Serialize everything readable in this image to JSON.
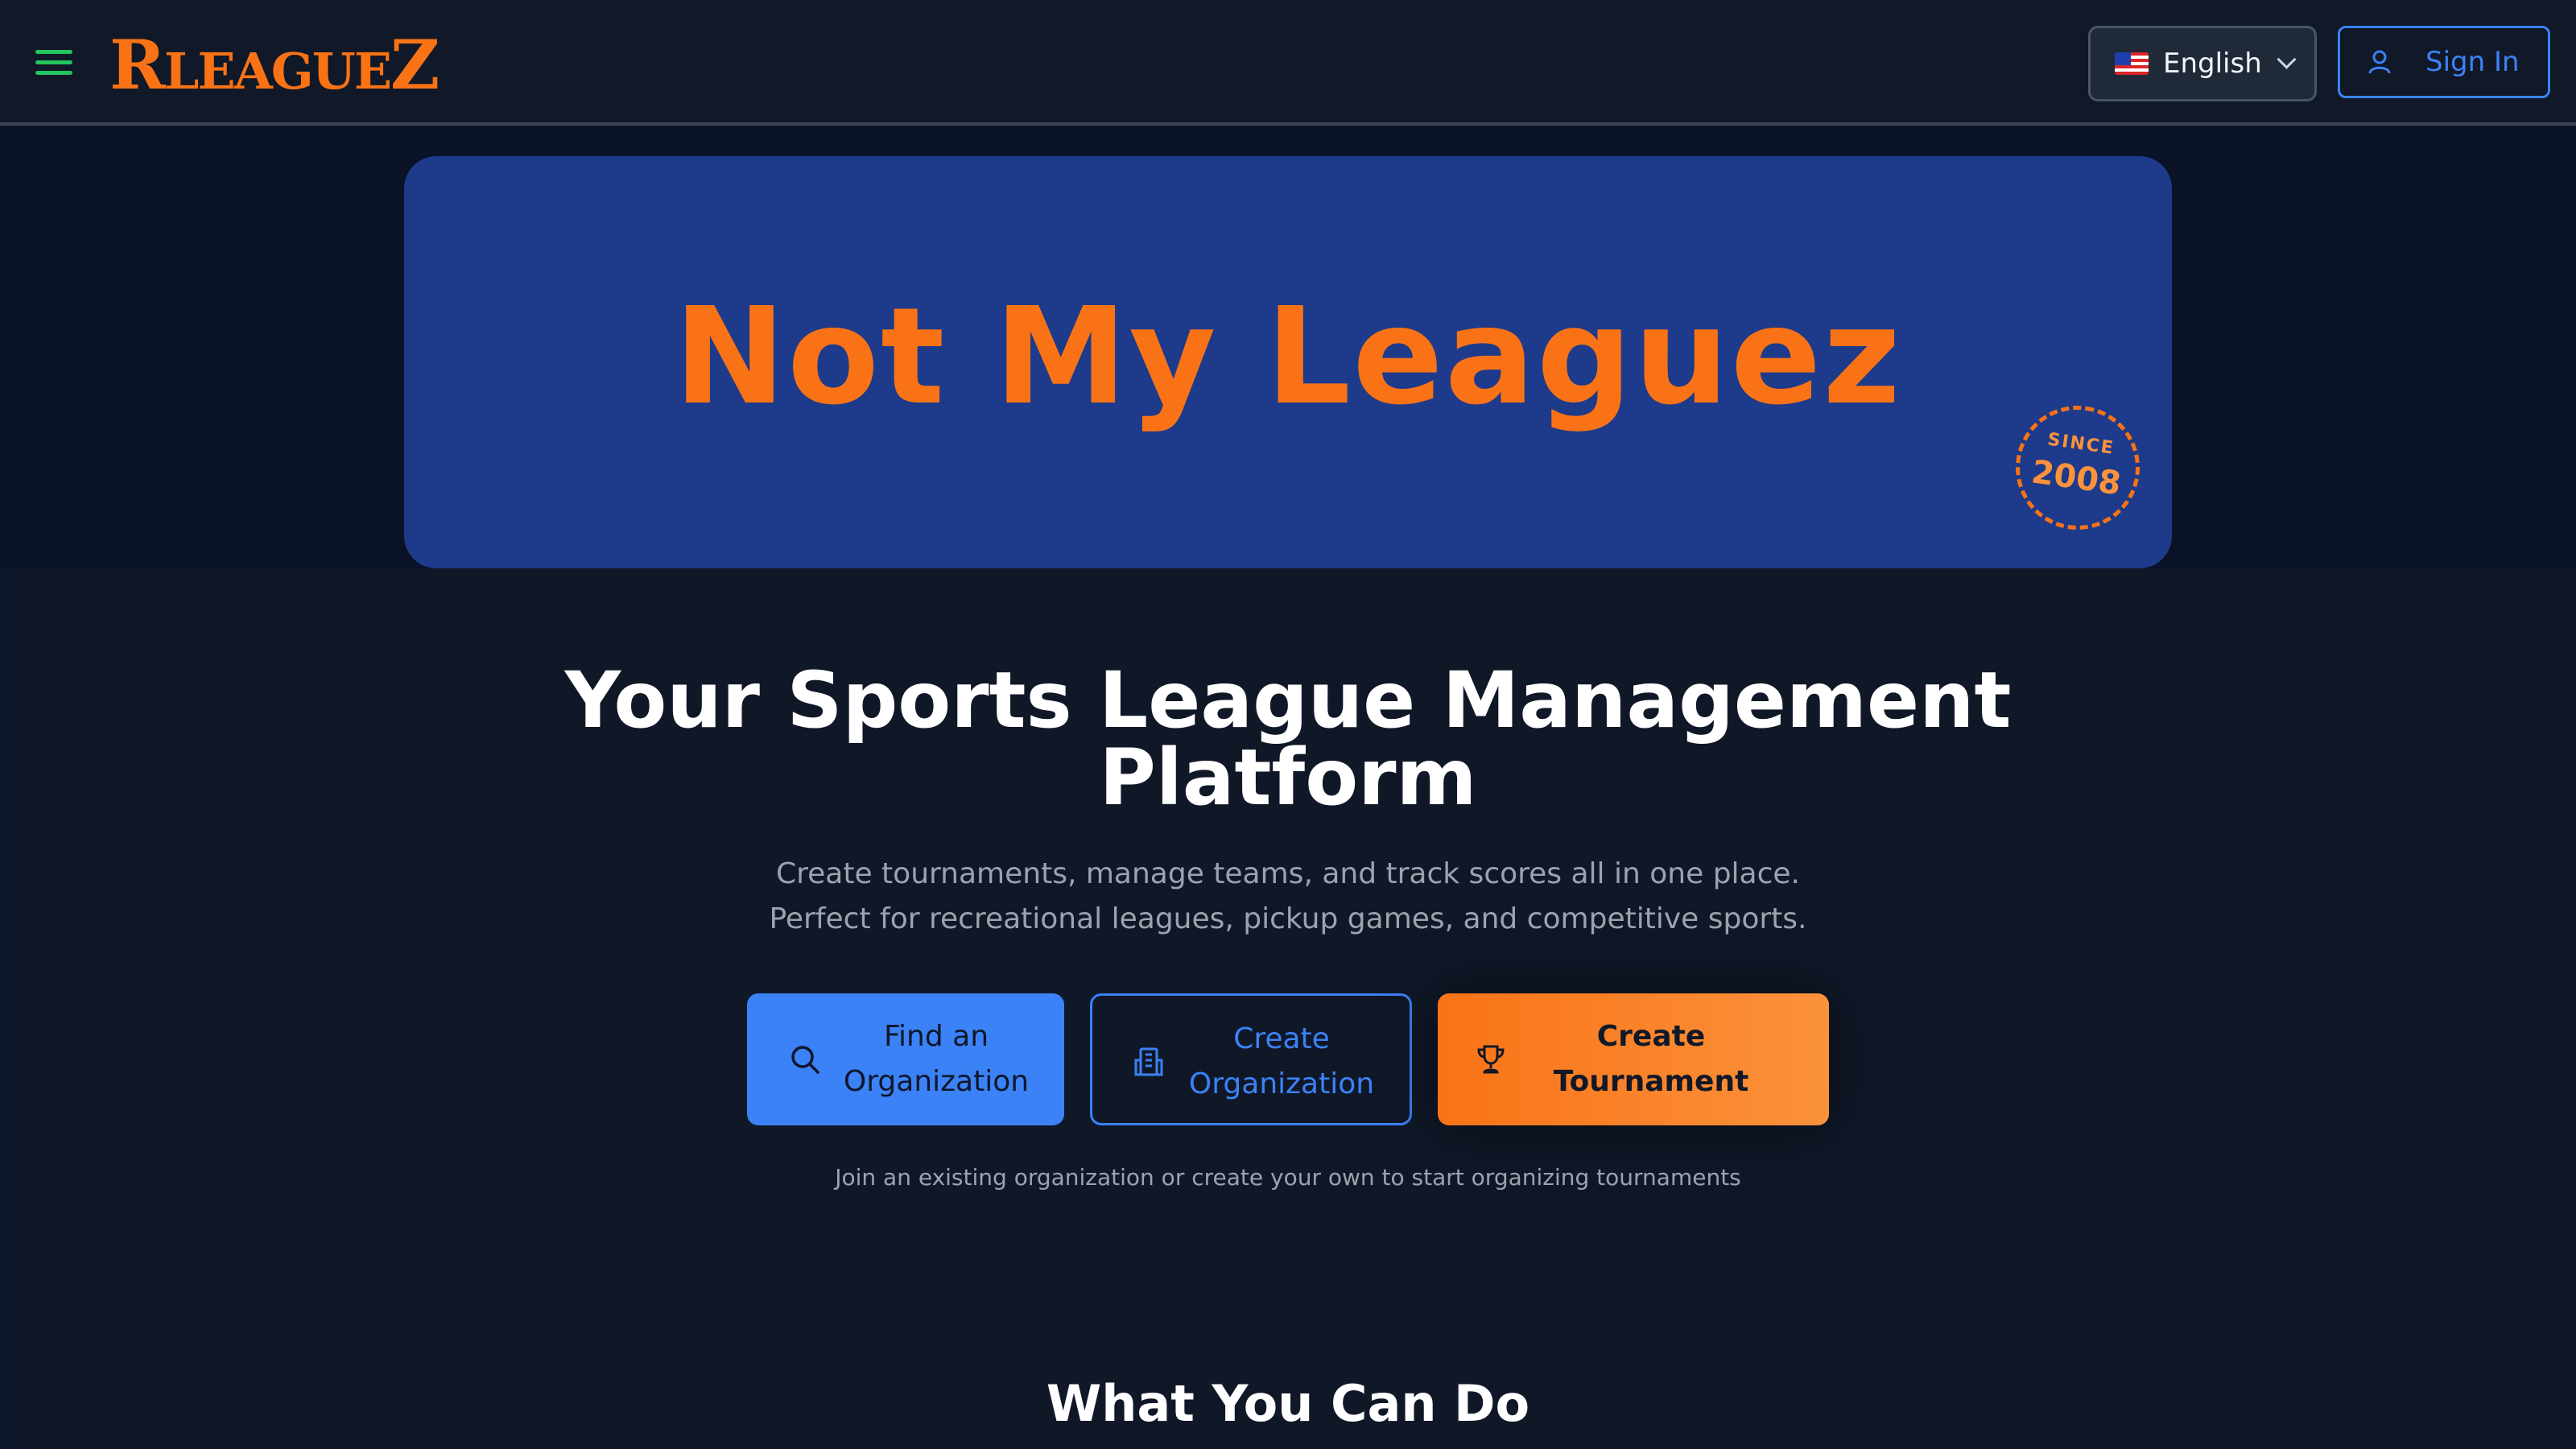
{
  "header": {
    "logo_text_first": "R",
    "logo_text_middle": "LEAGUE",
    "logo_text_last": "Z",
    "language": {
      "selected": "English",
      "flag_icon": "us-flag-icon"
    },
    "sign_in_label": "Sign In"
  },
  "banner": {
    "title": "Not My Leaguez",
    "badge_since": "SINCE",
    "badge_year": "2008"
  },
  "hero": {
    "headline_line1": "Your Sports League Management",
    "headline_line2": "Platform",
    "subtitle_line1": "Create tournaments, manage teams, and track scores all in one place.",
    "subtitle_line2": "Perfect for recreational leagues, pickup games, and competitive sports.",
    "buttons": {
      "find_line1": "Find an",
      "find_line2": "Organization",
      "create_org_line1": "Create",
      "create_org_line2": "Organization",
      "create_tournament_line1": "Create",
      "create_tournament_line2": "Tournament"
    },
    "hint": "Join an existing organization or create your own to start organizing tournaments"
  },
  "features": {
    "title": "What You Can Do"
  },
  "colors": {
    "accent_orange": "#f97316",
    "accent_blue": "#3b82f6",
    "menu_green": "#22c55e",
    "banner_blue": "#1e3a8a",
    "background": "#0f172a"
  }
}
